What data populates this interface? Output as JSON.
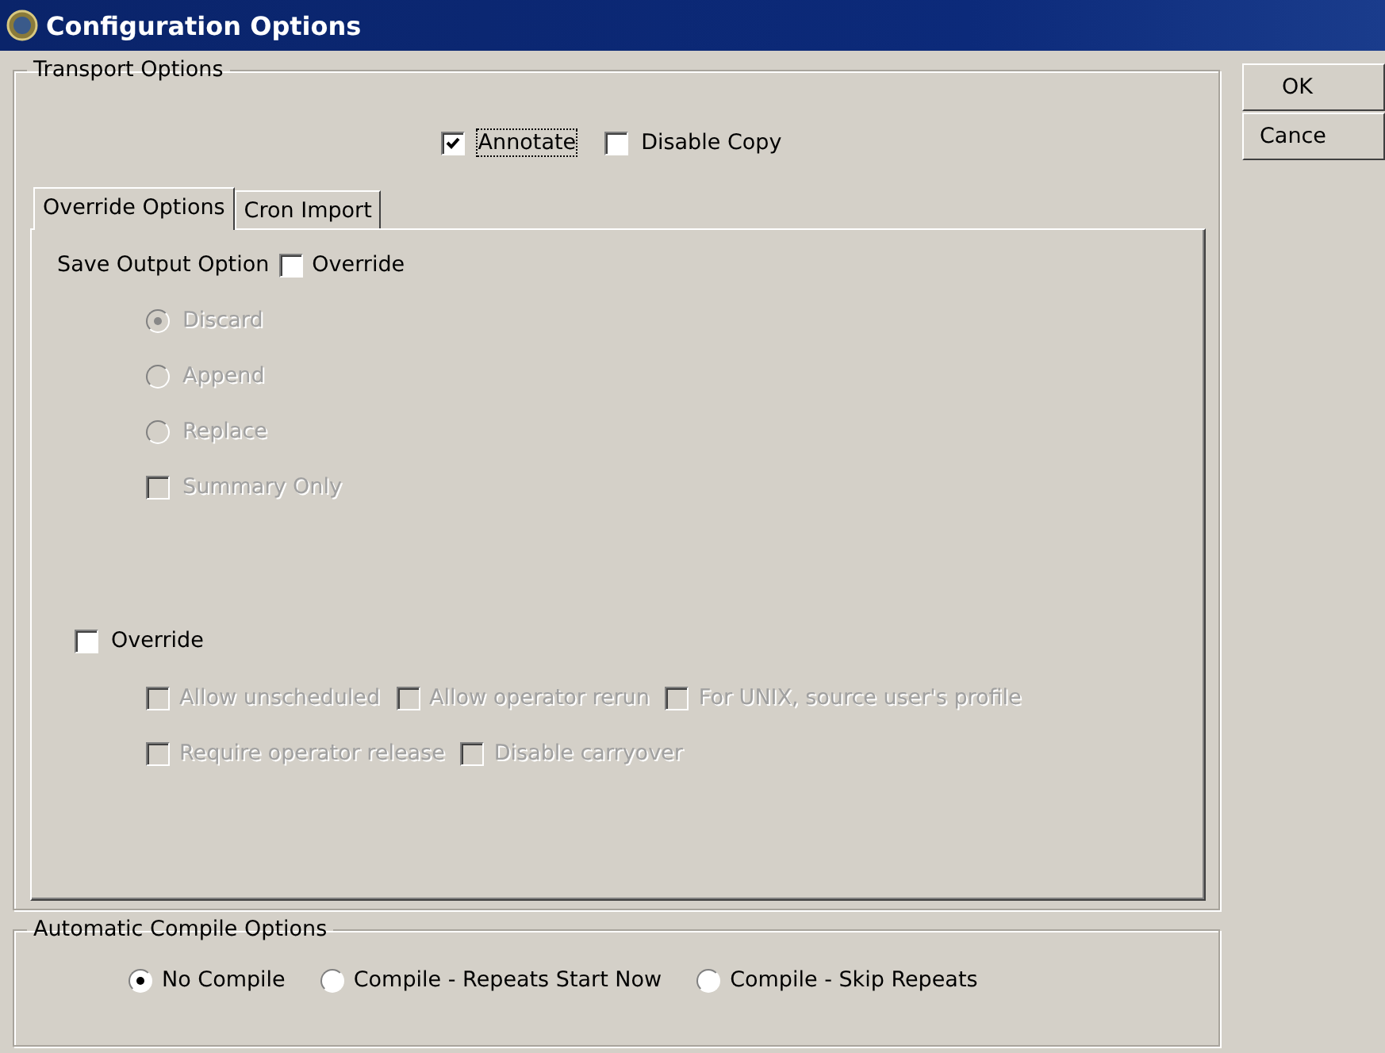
{
  "window": {
    "title": "Configuration Options"
  },
  "transport_options": {
    "title": "Transport Options",
    "checkboxes": [
      {
        "label": "Annotate",
        "checked": true,
        "focused": true
      },
      {
        "label": "Disable Copy",
        "checked": false,
        "focused": false
      }
    ],
    "tabs": [
      {
        "label": "Override Options",
        "selected": true
      },
      {
        "label": "Cron Import",
        "selected": false
      }
    ],
    "save_output": {
      "label": "Save Output Option",
      "override": {
        "label": "Override",
        "checked": false
      },
      "options": [
        {
          "kind": "radio",
          "label": "Discard",
          "checked": true,
          "disabled": true
        },
        {
          "kind": "radio",
          "label": "Append",
          "checked": false,
          "disabled": true
        },
        {
          "kind": "radio",
          "label": "Replace",
          "checked": false,
          "disabled": true
        },
        {
          "kind": "checkbox",
          "label": "Summary Only",
          "checked": false,
          "disabled": true
        }
      ]
    },
    "override": {
      "label": "Override",
      "checked": false,
      "rows": [
        [
          {
            "label": "Allow unscheduled",
            "checked": false,
            "disabled": true
          },
          {
            "label": "Allow operator rerun",
            "checked": false,
            "disabled": true
          },
          {
            "label": "For UNIX, source user's profile",
            "checked": false,
            "disabled": true
          }
        ],
        [
          {
            "label": "Require operator release",
            "checked": false,
            "disabled": true
          },
          {
            "label": "Disable carryover",
            "checked": false,
            "disabled": true
          }
        ]
      ]
    }
  },
  "compile_options": {
    "title": "Automatic Compile Options",
    "options": [
      {
        "label": "No Compile",
        "selected": true
      },
      {
        "label": "Compile - Repeats Start Now",
        "selected": false
      },
      {
        "label": "Compile - Skip Repeats",
        "selected": false
      }
    ]
  },
  "buttons": [
    "OK",
    "Cance"
  ]
}
